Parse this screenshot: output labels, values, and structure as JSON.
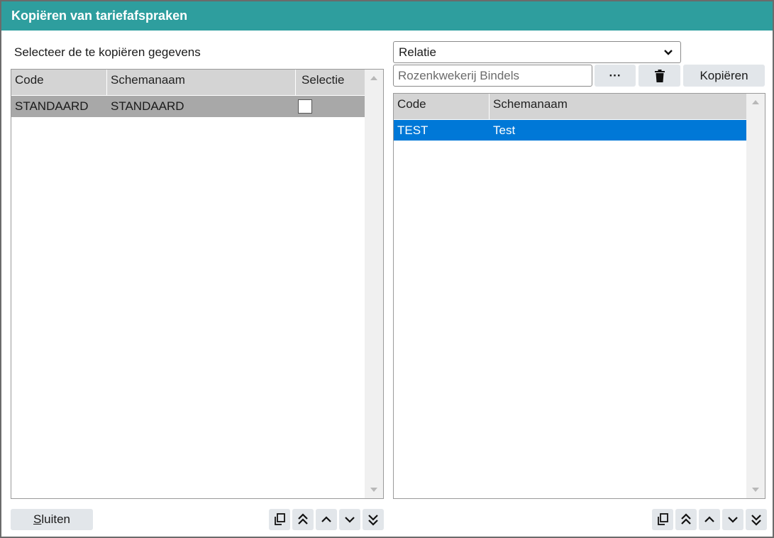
{
  "window": {
    "title": "Kopiëren van tariefafspraken"
  },
  "instruction": "Selecteer de te kopiëren gegevens",
  "left_grid": {
    "columns": [
      "Code",
      "Schemanaam",
      "Selectie"
    ],
    "rows": [
      {
        "code": "STANDAARD",
        "schemanaam": "STANDAARD",
        "selectie": false
      }
    ]
  },
  "relation_select": {
    "value": "Relatie"
  },
  "relation_input": {
    "value": "Rozenkwekerij Bindels"
  },
  "buttons": {
    "browse": "···",
    "copy": "Kopiëren",
    "close_first": "S",
    "close_rest": "luiten"
  },
  "right_grid": {
    "columns": [
      "Code",
      "Schemanaam"
    ],
    "rows": [
      {
        "code": "TEST",
        "schemanaam": "Test"
      }
    ]
  },
  "colors": {
    "titlebar": "#2e9e9e",
    "selected_row": "#0078d7",
    "highlight_row": "#a8a8a8",
    "header": "#d4d4d4"
  }
}
